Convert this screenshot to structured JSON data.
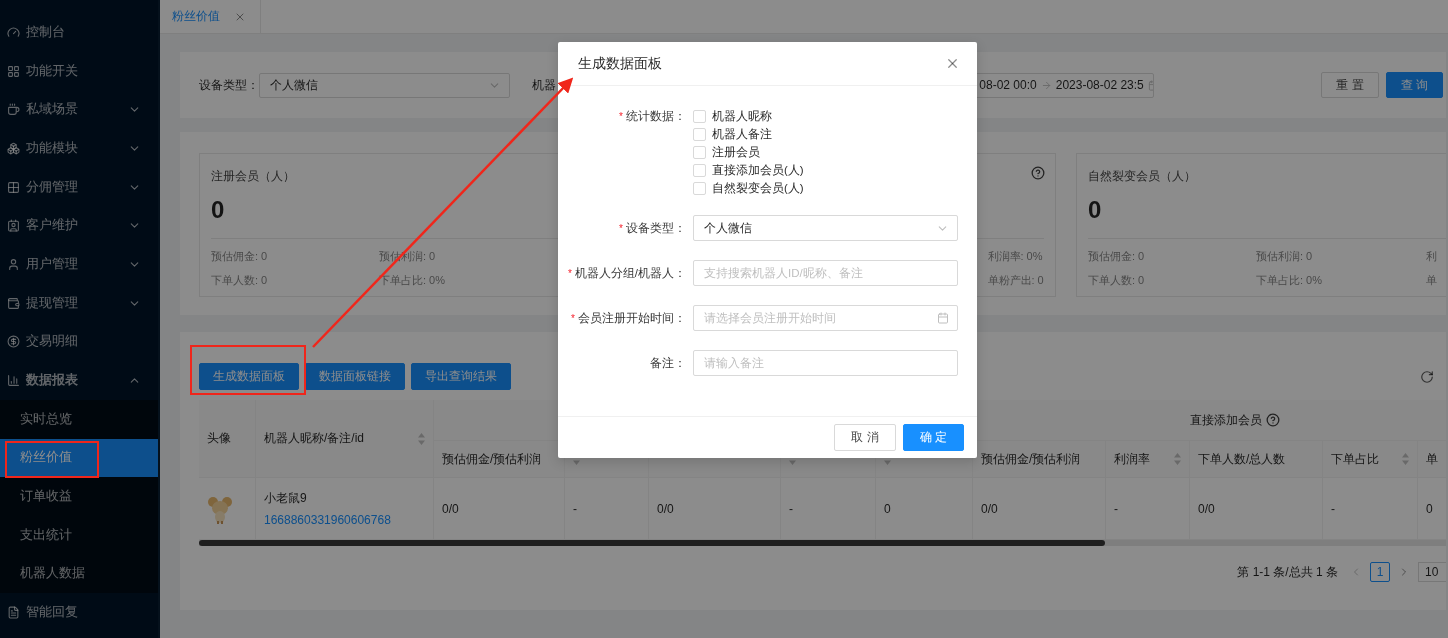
{
  "sidebar": {
    "items": [
      {
        "label": "控制台"
      },
      {
        "label": "功能开关"
      },
      {
        "label": "私域场景",
        "expanded": false
      },
      {
        "label": "功能模块",
        "expanded": false
      },
      {
        "label": "分佣管理",
        "expanded": false
      },
      {
        "label": "客户维护",
        "expanded": false
      },
      {
        "label": "用户管理",
        "expanded": false
      },
      {
        "label": "提现管理",
        "expanded": false
      },
      {
        "label": "交易明细"
      },
      {
        "label": "数据报表",
        "expanded": true,
        "children": [
          {
            "label": "实时总览",
            "selected": false
          },
          {
            "label": "粉丝价值",
            "selected": true
          },
          {
            "label": "订单收益",
            "selected": false
          },
          {
            "label": "支出统计",
            "selected": false
          },
          {
            "label": "机器人数据",
            "selected": false
          }
        ]
      },
      {
        "label": "智能回复"
      }
    ]
  },
  "tabs": [
    {
      "label": "粉丝价值",
      "selected": true
    }
  ],
  "filters": {
    "device_type": {
      "label": "设备类型：",
      "value": "个人微信"
    },
    "robot_label": "机器",
    "date_range": {
      "start": "08-02 00:0",
      "end": "2023-08-02 23:5"
    },
    "buttons": [
      {
        "label": "重 置",
        "kind": "default"
      },
      {
        "label": "查 询",
        "kind": "primary"
      }
    ]
  },
  "stat_cards": [
    {
      "title": "注册会员（人）",
      "value": "0",
      "help": false,
      "metrics": [
        {
          "col_1": "预估佣金: 0",
          "col_2": "预估利润: 0"
        },
        {
          "col_1": "下单人数: 0",
          "col_2": "下单占比: 0%"
        }
      ]
    },
    {
      "help": true,
      "metrics": [
        {
          "col_3": "利润率: 0%"
        },
        {
          "col_3": "单粉产出: 0"
        }
      ]
    },
    {
      "title": "自然裂变会员（人）",
      "value": "0",
      "help": false,
      "metrics": [
        {
          "col_1": "预估佣金: 0",
          "col_2": "预估利润: 0",
          "col_3": "利"
        },
        {
          "col_1": "下单人数: 0",
          "col_2": "下单占比: 0%",
          "col_3": "单"
        }
      ]
    }
  ],
  "table": {
    "actions": [
      "生成数据面板",
      "数据面板链接",
      "导出查询结果"
    ],
    "columns": [
      {
        "label": "头像",
        "sortable": false
      },
      {
        "label": "机器人昵称/备注/id",
        "sortable": true
      }
    ],
    "column_groups": [
      {
        "columns": [
          {
            "label": "预估佣金/预估利润",
            "sortable": false
          },
          {
            "sortable": true
          },
          {
            "sortable": false
          },
          {
            "sortable": true
          },
          {
            "sortable": true
          }
        ]
      },
      {
        "label": "直接添加会员",
        "help": true,
        "columns": [
          {
            "label": "预估佣金/预估利润",
            "sortable": false
          },
          {
            "label": "利润率",
            "sortable": true
          },
          {
            "label": "下单人数/总人数",
            "sortable": false
          },
          {
            "label": "下单占比",
            "sortable": true
          },
          {
            "label": "单"
          }
        ]
      }
    ],
    "rows": [
      {
        "avatar": {
          "kind": "picture"
        },
        "name": "小老鼠9",
        "id": "1668860331960606768",
        "cells": [
          "0/0",
          "-",
          "0/0",
          "-",
          "0",
          "0/0",
          "-",
          "0/0",
          "-",
          "0"
        ]
      }
    ]
  },
  "pagination": {
    "summary": "第 1-1 条/总共 1 条",
    "pages": [
      {
        "label": "1",
        "selected": true
      }
    ],
    "page_size": "10"
  },
  "modal": {
    "title": "生成数据面板",
    "fields": [
      {
        "kind": "checkboxes",
        "label": "统计数据：",
        "required_mark": "*",
        "options": [
          {
            "label": "机器人昵称",
            "checked": false
          },
          {
            "label": "机器人备注",
            "checked": false
          },
          {
            "label": "注册会员",
            "checked": false
          },
          {
            "label": "直接添加会员(人)",
            "checked": false
          },
          {
            "label": "自然裂变会员(人)",
            "checked": false
          }
        ]
      },
      {
        "kind": "select",
        "label": "设备类型：",
        "required_mark": "*",
        "value": "个人微信"
      },
      {
        "kind": "input",
        "label": "机器人分组/机器人：",
        "required_mark": "*",
        "placeholder": "支持搜索机器人ID/昵称、备注"
      },
      {
        "kind": "date",
        "label": "会员注册开始时间：",
        "required_mark": "*",
        "placeholder": "请选择会员注册开始时间"
      },
      {
        "kind": "input",
        "label": "备注：",
        "placeholder": "请输入备注"
      }
    ],
    "buttons": [
      {
        "label": "取 消",
        "kind": "default"
      },
      {
        "label": "确 定",
        "kind": "primary"
      }
    ]
  }
}
